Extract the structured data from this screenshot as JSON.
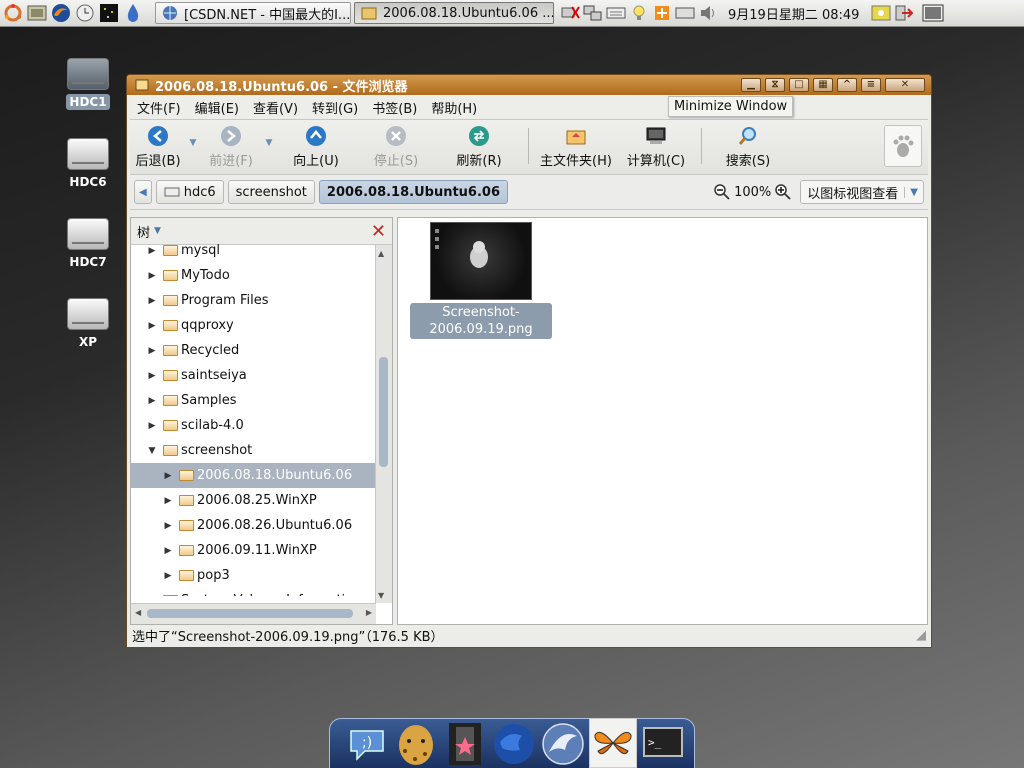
{
  "top_panel": {
    "tasks": [
      {
        "label": "[CSDN.NET - 中国最大的I...",
        "active": false
      },
      {
        "label": "2006.08.18.Ubuntu6.06 ...",
        "active": true
      }
    ],
    "clock": "9月19日星期二 08:49"
  },
  "desktop": {
    "icons": [
      {
        "label": "HDC1",
        "selected": true
      },
      {
        "label": "HDC6",
        "selected": false
      },
      {
        "label": "HDC7",
        "selected": false
      },
      {
        "label": "XP",
        "selected": false
      }
    ]
  },
  "window": {
    "title": "2006.08.18.Ubuntu6.06 - 文件浏览器",
    "menu": [
      "文件(F)",
      "编辑(E)",
      "查看(V)",
      "转到(G)",
      "书签(B)",
      "帮助(H)"
    ],
    "toolbar": {
      "back": "后退(B)",
      "forward": "前进(F)",
      "up": "向上(U)",
      "stop": "停止(S)",
      "reload": "刷新(R)",
      "home": "主文件夹(H)",
      "computer": "计算机(C)",
      "search": "搜索(S)"
    },
    "location": {
      "crumbs": [
        "hdc6",
        "screenshot",
        "2006.08.18.Ubuntu6.06"
      ],
      "zoom": "100%",
      "view_mode": "以图标视图查看"
    },
    "sidepane": {
      "header": "树",
      "tree": [
        {
          "label": "mysql",
          "depth": 0,
          "expanded": false,
          "selected": false
        },
        {
          "label": "MyTodo",
          "depth": 0,
          "expanded": false,
          "selected": false
        },
        {
          "label": "Program Files",
          "depth": 0,
          "expanded": false,
          "selected": false
        },
        {
          "label": "qqproxy",
          "depth": 0,
          "expanded": false,
          "selected": false
        },
        {
          "label": "Recycled",
          "depth": 0,
          "expanded": false,
          "selected": false
        },
        {
          "label": "saintseiya",
          "depth": 0,
          "expanded": false,
          "selected": false
        },
        {
          "label": "Samples",
          "depth": 0,
          "expanded": false,
          "selected": false
        },
        {
          "label": "scilab-4.0",
          "depth": 0,
          "expanded": false,
          "selected": false
        },
        {
          "label": "screenshot",
          "depth": 0,
          "expanded": true,
          "selected": false
        },
        {
          "label": "2006.08.18.Ubuntu6.06",
          "depth": 1,
          "expanded": false,
          "selected": true
        },
        {
          "label": "2006.08.25.WinXP",
          "depth": 1,
          "expanded": false,
          "selected": false
        },
        {
          "label": "2006.08.26.Ubuntu6.06",
          "depth": 1,
          "expanded": false,
          "selected": false
        },
        {
          "label": "2006.09.11.WinXP",
          "depth": 1,
          "expanded": false,
          "selected": false
        },
        {
          "label": "pop3",
          "depth": 1,
          "expanded": false,
          "selected": false
        },
        {
          "label": "System Volume Information",
          "depth": 0,
          "expanded": false,
          "selected": false
        }
      ]
    },
    "file": {
      "name": "Screenshot-2006.09.19.png"
    },
    "status": "选中了“Screenshot-2006.09.19.png”（176.5 KB）"
  },
  "tooltip": "Minimize Window",
  "dock": {
    "items": [
      "chat-icon",
      "cheetah-icon",
      "film-icon",
      "globe-icon",
      "dolphin-icon",
      "butterfly-icon",
      "terminal-icon"
    ]
  },
  "colors": {
    "titlebar": "#c07a2a",
    "selection": "#a9b4c0",
    "dock": "#2a4a80"
  }
}
